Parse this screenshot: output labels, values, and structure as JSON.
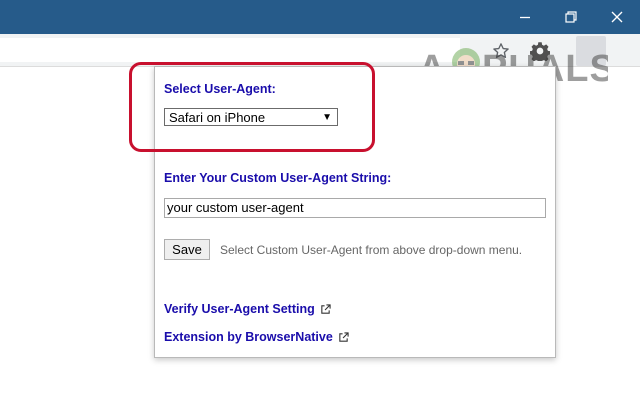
{
  "window": {
    "minimize_icon": "minimize-icon",
    "maximize_icon": "restore-icon",
    "close_icon": "close-icon"
  },
  "toolbar": {
    "bookmark_icon": "star-icon",
    "extension_icon": "gear-icon"
  },
  "watermark": {
    "text": "APPUALS"
  },
  "popup": {
    "select_label": "Select User-Agent:",
    "select_value": "Safari on iPhone",
    "custom_label": "Enter Your Custom User-Agent String:",
    "custom_value": "your custom user-agent",
    "save_label": "Save",
    "hint": "Select Custom User-Agent from above drop-down menu.",
    "verify_link": "Verify User-Agent Setting",
    "extension_link": "Extension by BrowserNative"
  },
  "colors": {
    "titlebar": "#265b8a",
    "link": "#1a0dab",
    "highlight": "#c8102e"
  }
}
